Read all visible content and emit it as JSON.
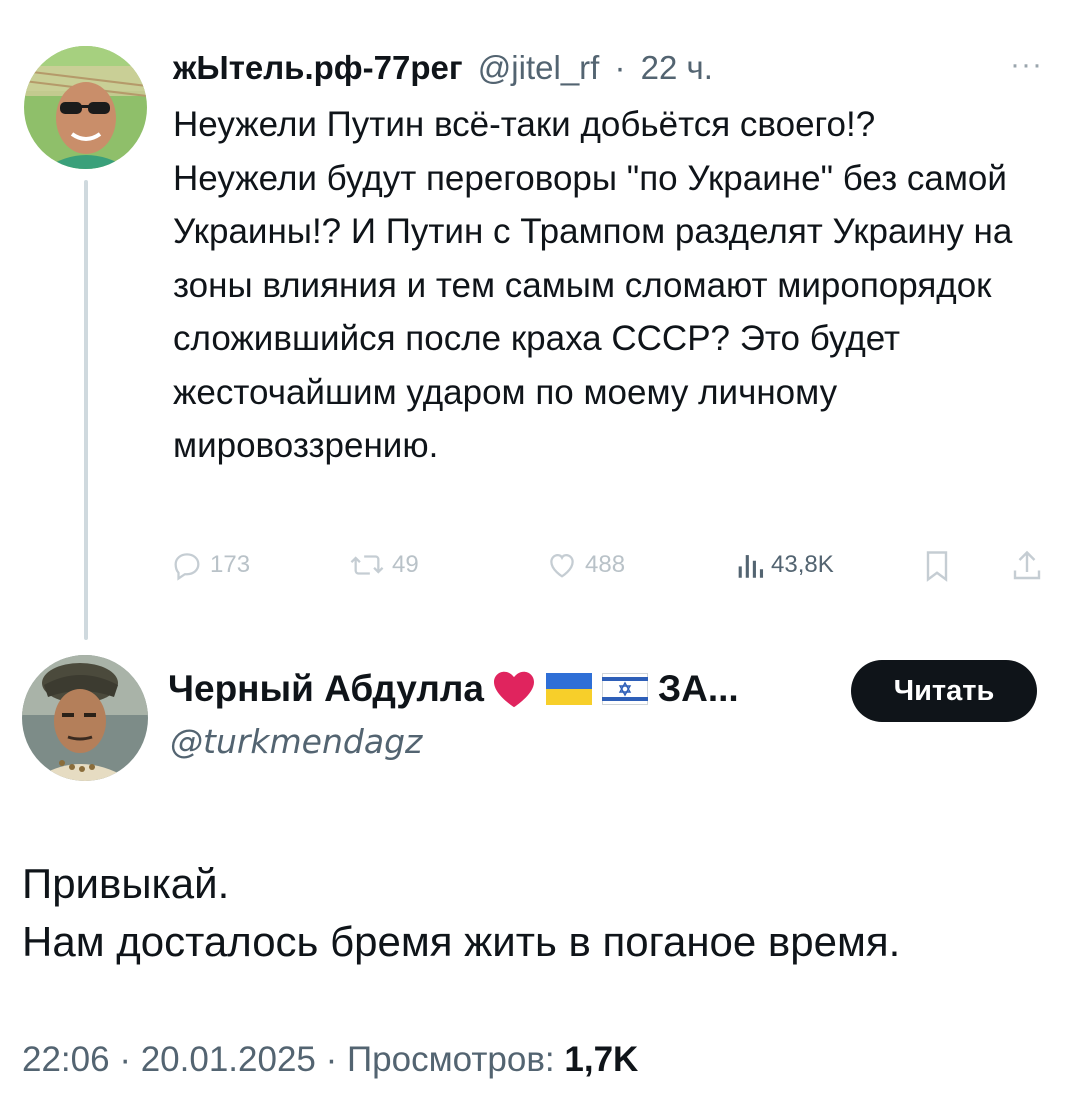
{
  "parent_tweet": {
    "author_name": "жЫтель.рф-77рег",
    "author_handle": "@jitel_rf",
    "separator": "·",
    "time_ago": "22 ч.",
    "more_label": "···",
    "text": "Неужели Путин всё-таки добьётся своего!?\nНеужели будут переговоры \"по Украине\" без самой Украины!? И Путин с Трампом разделят Украину на зоны влияния и тем самым сломают миропорядок сложившийся после краха СССР? Это будет жесточайшим ударом по моему личному мировоззрению.",
    "actions": {
      "replies": "173",
      "reposts": "49",
      "likes": "488",
      "views": "43,8K"
    },
    "icons": [
      "reply-icon",
      "repost-icon",
      "like-icon",
      "views-icon",
      "bookmark-icon",
      "share-icon"
    ]
  },
  "reply_tweet": {
    "author_name": "Черный Абдулла",
    "name_suffix": "ЗА...",
    "author_handle": "@turkmendagz",
    "follow_label": "Читать",
    "text_lines": [
      "Привыкай.",
      "Нам досталось бремя жить в поганое время."
    ],
    "footer": {
      "time": "22:06",
      "date": "20.01.2025",
      "views_label": "Просмотров:",
      "views_count": "1,7K"
    }
  },
  "colors": {
    "text": "#0f1419",
    "secondary": "#536471",
    "muted_actions": "#b9c2c8",
    "thread_line": "#cfd9de",
    "button_bg": "#0f1419",
    "heart": "#e0245e"
  }
}
